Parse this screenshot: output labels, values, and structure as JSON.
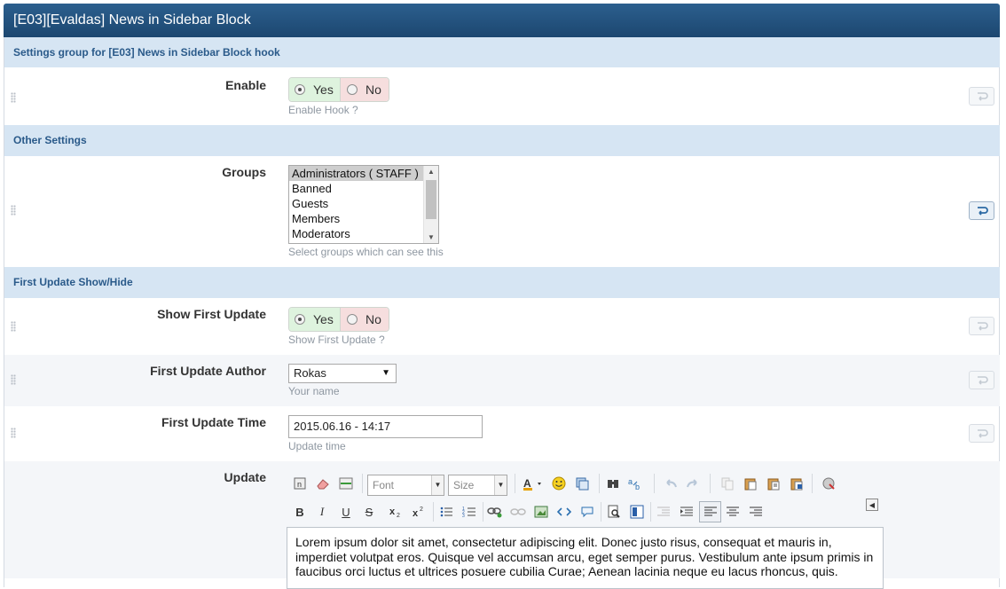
{
  "window": {
    "title": "[E03][Evaldas] News in Sidebar Block"
  },
  "sections": {
    "s1": "Settings group for [E03] News in Sidebar Block hook",
    "s2": "Other Settings",
    "s3": "First Update Show/Hide"
  },
  "enable": {
    "label": "Enable",
    "yes": "Yes",
    "no": "No",
    "selected": "Yes",
    "desc": "Enable Hook ?"
  },
  "groups": {
    "label": "Groups",
    "options": [
      "Administrators ( STAFF )",
      "Banned",
      "Guests",
      "Members",
      "Moderators"
    ],
    "selected": "Administrators ( STAFF )",
    "desc": "Select groups which can see this"
  },
  "show_first": {
    "label": "Show First Update",
    "yes": "Yes",
    "no": "No",
    "selected": "Yes",
    "desc": "Show First Update ?"
  },
  "author": {
    "label": "First Update Author",
    "value": "Rokas",
    "desc": "Your name"
  },
  "time": {
    "label": "First Update Time",
    "value": "2015.06.16 - 14:17",
    "desc": "Update time"
  },
  "update": {
    "label": "Update",
    "toolbar": {
      "font": "Font",
      "size": "Size",
      "bold": "B",
      "italic": "I",
      "underline": "U",
      "strike": "S"
    },
    "content": "Lorem ipsum dolor sit amet, consectetur adipiscing elit. Donec justo risus, consequat et mauris in, imperdiet volutpat eros. Quisque vel accumsan arcu, eget semper purus. Vestibulum ante ipsum primis in faucibus orci luctus et ultrices posuere cubilia Curae; Aenean lacinia neque eu lacus rhoncus, quis."
  },
  "colors": {
    "title_bg": "#1c4770",
    "section_bg": "#d6e5f3",
    "yes_bg": "#def3de",
    "no_bg": "#f6dede"
  },
  "icons": [
    "grip-icon",
    "revert-icon",
    "smiley-icon",
    "undo-icon",
    "redo-icon"
  ]
}
